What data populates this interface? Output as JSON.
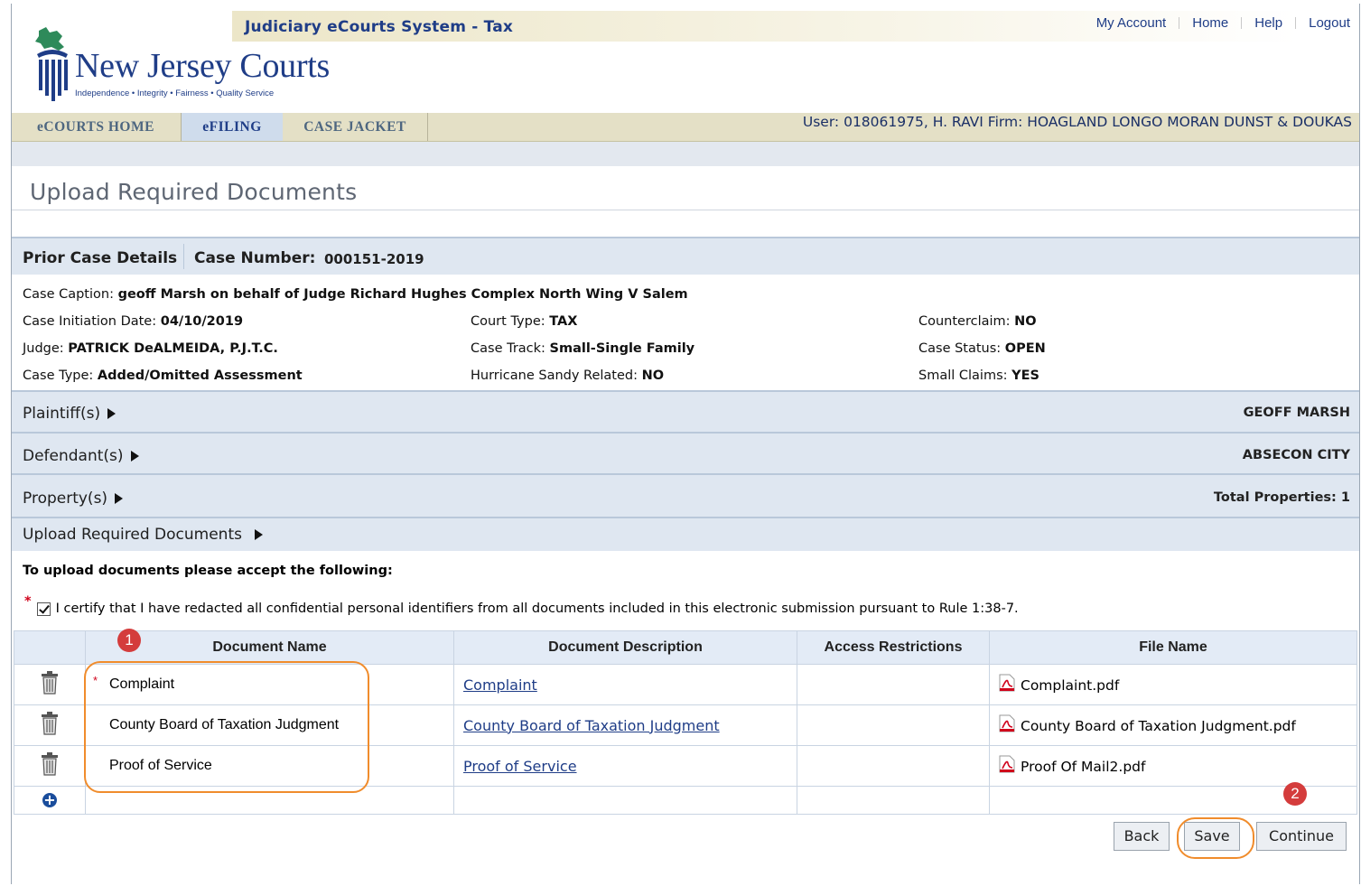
{
  "header": {
    "system_title": "Judiciary eCourts System - Tax",
    "links": [
      "My Account",
      "Home",
      "Help",
      "Logout"
    ],
    "logo_name": "New Jersey Courts",
    "logo_tagline": "Independence • Integrity • Fairness • Quality Service"
  },
  "nav": {
    "tabs": [
      "eCOURTS HOME",
      "eFILING",
      "CASE JACKET"
    ],
    "active_tab": "eFILING",
    "user_info": "User: 018061975, H. RAVI  Firm: HOAGLAND LONGO MORAN DUNST & DOUKAS"
  },
  "page": {
    "title": "Upload Required Documents"
  },
  "case": {
    "section_label": "Prior Case Details",
    "case_number_label": "Case Number:",
    "case_number": "000151-2019",
    "caption_label": "Case Caption:",
    "caption": "geoff Marsh on behalf of Judge Richard Hughes Complex North Wing V Salem",
    "initiation_label": "Case Initiation Date:",
    "initiation": "04/10/2019",
    "court_type_label": "Court Type:",
    "court_type": "TAX",
    "counterclaim_label": "Counterclaim:",
    "counterclaim": "NO",
    "judge_label": "Judge:",
    "judge": "PATRICK DeALMEIDA, P.J.T.C.",
    "track_label": "Case Track:",
    "track": "Small-Single Family",
    "status_label": "Case Status:",
    "status": "OPEN",
    "type_label": "Case Type:",
    "type": "Added/Omitted Assessment",
    "sandy_label": "Hurricane Sandy Related:",
    "sandy": "NO",
    "small_claims_label": "Small Claims:",
    "small_claims": "YES"
  },
  "sections": {
    "plaintiffs_label": "Plaintiff(s)",
    "plaintiffs_value": "GEOFF MARSH",
    "defendants_label": "Defendant(s)",
    "defendants_value": "ABSECON CITY",
    "properties_label": "Property(s)",
    "properties_value": "Total Properties: 1",
    "upload_label": "Upload Required Documents"
  },
  "upload": {
    "instruction": "To upload documents please accept the following:",
    "required_marker": "*",
    "certify_checked": true,
    "certify_text": "I certify that I have redacted all confidential personal identifiers from all documents included in this electronic submission pursuant to Rule 1:38-7.",
    "columns": [
      "Document Name",
      "Document Description",
      "Access Restrictions",
      "File Name"
    ],
    "rows": [
      {
        "name": "Complaint",
        "required": "*",
        "description": "Complaint",
        "access": "",
        "file": "Complaint.pdf"
      },
      {
        "name": "County Board of Taxation Judgment",
        "required": "",
        "description": "County Board of Taxation Judgment",
        "access": "",
        "file": "County Board of Taxation Judgment.pdf"
      },
      {
        "name": "Proof of Service",
        "required": "",
        "description": "Proof of Service",
        "access": "",
        "file": "Proof Of Mail2.pdf"
      }
    ],
    "add_icon": "plus-circle-icon"
  },
  "buttons": {
    "back": "Back",
    "save": "Save",
    "continue": "Continue"
  },
  "annotations": {
    "badge1": "1",
    "badge2": "2"
  },
  "colors": {
    "brand_blue": "#1f3d87",
    "annotation_orange": "#f08c2c",
    "badge_red": "#d43c3c",
    "required_red": "#d0021b"
  }
}
